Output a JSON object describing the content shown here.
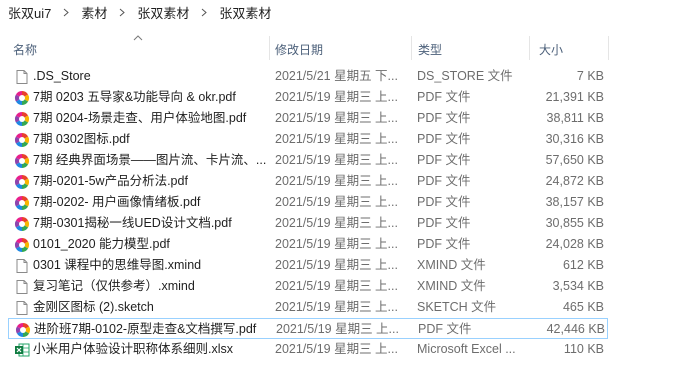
{
  "breadcrumb": [
    "张双ui7",
    "素材",
    "张双素材",
    "张双素材"
  ],
  "columns": {
    "name": "名称",
    "date": "修改日期",
    "type": "类型",
    "size": "大小"
  },
  "icon_names": {
    "pdf": "pdf-app-icon",
    "doc": "generic-file-icon",
    "xlsx": "excel-file-icon"
  },
  "files": [
    {
      "name": ".DS_Store",
      "date": "2021/5/21 星期五 下...",
      "type": "DS_STORE 文件",
      "size": "7 KB",
      "icon": "doc"
    },
    {
      "name": "7期  0203 五导家&功能导向 & okr.pdf",
      "date": "2021/5/19 星期三 上...",
      "type": "PDF 文件",
      "size": "21,391 KB",
      "icon": "pdf"
    },
    {
      "name": "7期  0204-场景走查、用户体验地图.pdf",
      "date": "2021/5/19 星期三 上...",
      "type": "PDF 文件",
      "size": "38,811 KB",
      "icon": "pdf"
    },
    {
      "name": "7期 0302图标.pdf",
      "date": "2021/5/19 星期三 上...",
      "type": "PDF 文件",
      "size": "30,316 KB",
      "icon": "pdf"
    },
    {
      "name": "7期 经典界面场景——图片流、卡片流、...",
      "date": "2021/5/19 星期三 上...",
      "type": "PDF 文件",
      "size": "57,650 KB",
      "icon": "pdf"
    },
    {
      "name": "7期-0201-5w产品分析法.pdf",
      "date": "2021/5/19 星期三 上...",
      "type": "PDF 文件",
      "size": "24,872 KB",
      "icon": "pdf"
    },
    {
      "name": "7期-0202- 用户画像情绪板.pdf",
      "date": "2021/5/19 星期三 上...",
      "type": "PDF 文件",
      "size": "38,157 KB",
      "icon": "pdf"
    },
    {
      "name": "7期-0301揭秘一线UED设计文档.pdf",
      "date": "2021/5/19 星期三 上...",
      "type": "PDF 文件",
      "size": "30,855 KB",
      "icon": "pdf"
    },
    {
      "name": "0101_2020 能力模型.pdf",
      "date": "2021/5/19 星期三 上...",
      "type": "PDF 文件",
      "size": "24,028 KB",
      "icon": "pdf"
    },
    {
      "name": "0301 课程中的思维导图.xmind",
      "date": "2021/5/19 星期三 上...",
      "type": "XMIND 文件",
      "size": "612 KB",
      "icon": "doc"
    },
    {
      "name": "复习笔记（仅供参考）.xmind",
      "date": "2021/5/19 星期三 上...",
      "type": "XMIND 文件",
      "size": "3,534 KB",
      "icon": "doc"
    },
    {
      "name": "金刚区图标 (2).sketch",
      "date": "2021/5/19 星期三 上...",
      "type": "SKETCH 文件",
      "size": "465 KB",
      "icon": "doc"
    },
    {
      "name": "进阶班7期-0102-原型走查&文档撰写.pdf",
      "date": "2021/5/19 星期三 上...",
      "type": "PDF 文件",
      "size": "42,446 KB",
      "icon": "pdf",
      "selected": true
    },
    {
      "name": "小米用户体验设计职称体系细则.xlsx",
      "date": "2021/5/19 星期三 上...",
      "type": "Microsoft Excel ...",
      "size": "110 KB",
      "icon": "xlsx"
    }
  ]
}
